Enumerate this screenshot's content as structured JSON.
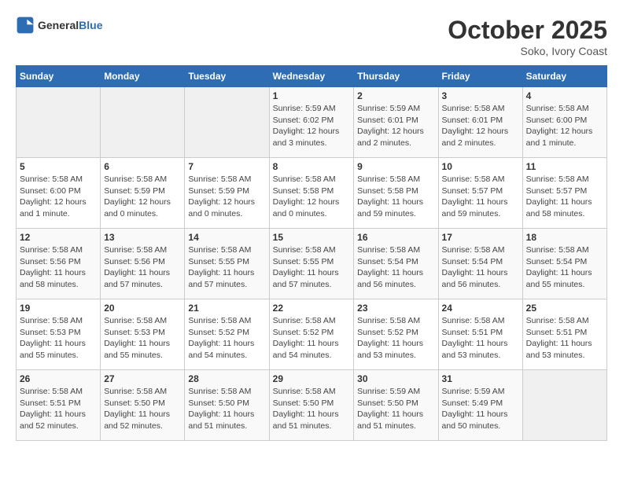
{
  "logo": {
    "text_general": "General",
    "text_blue": "Blue"
  },
  "title": "October 2025",
  "location": "Soko, Ivory Coast",
  "days_of_week": [
    "Sunday",
    "Monday",
    "Tuesday",
    "Wednesday",
    "Thursday",
    "Friday",
    "Saturday"
  ],
  "weeks": [
    [
      {
        "day": "",
        "info": ""
      },
      {
        "day": "",
        "info": ""
      },
      {
        "day": "",
        "info": ""
      },
      {
        "day": "1",
        "info": "Sunrise: 5:59 AM\nSunset: 6:02 PM\nDaylight: 12 hours\nand 3 minutes."
      },
      {
        "day": "2",
        "info": "Sunrise: 5:59 AM\nSunset: 6:01 PM\nDaylight: 12 hours\nand 2 minutes."
      },
      {
        "day": "3",
        "info": "Sunrise: 5:58 AM\nSunset: 6:01 PM\nDaylight: 12 hours\nand 2 minutes."
      },
      {
        "day": "4",
        "info": "Sunrise: 5:58 AM\nSunset: 6:00 PM\nDaylight: 12 hours\nand 1 minute."
      }
    ],
    [
      {
        "day": "5",
        "info": "Sunrise: 5:58 AM\nSunset: 6:00 PM\nDaylight: 12 hours\nand 1 minute."
      },
      {
        "day": "6",
        "info": "Sunrise: 5:58 AM\nSunset: 5:59 PM\nDaylight: 12 hours\nand 0 minutes."
      },
      {
        "day": "7",
        "info": "Sunrise: 5:58 AM\nSunset: 5:59 PM\nDaylight: 12 hours\nand 0 minutes."
      },
      {
        "day": "8",
        "info": "Sunrise: 5:58 AM\nSunset: 5:58 PM\nDaylight: 12 hours\nand 0 minutes."
      },
      {
        "day": "9",
        "info": "Sunrise: 5:58 AM\nSunset: 5:58 PM\nDaylight: 11 hours\nand 59 minutes."
      },
      {
        "day": "10",
        "info": "Sunrise: 5:58 AM\nSunset: 5:57 PM\nDaylight: 11 hours\nand 59 minutes."
      },
      {
        "day": "11",
        "info": "Sunrise: 5:58 AM\nSunset: 5:57 PM\nDaylight: 11 hours\nand 58 minutes."
      }
    ],
    [
      {
        "day": "12",
        "info": "Sunrise: 5:58 AM\nSunset: 5:56 PM\nDaylight: 11 hours\nand 58 minutes."
      },
      {
        "day": "13",
        "info": "Sunrise: 5:58 AM\nSunset: 5:56 PM\nDaylight: 11 hours\nand 57 minutes."
      },
      {
        "day": "14",
        "info": "Sunrise: 5:58 AM\nSunset: 5:55 PM\nDaylight: 11 hours\nand 57 minutes."
      },
      {
        "day": "15",
        "info": "Sunrise: 5:58 AM\nSunset: 5:55 PM\nDaylight: 11 hours\nand 57 minutes."
      },
      {
        "day": "16",
        "info": "Sunrise: 5:58 AM\nSunset: 5:54 PM\nDaylight: 11 hours\nand 56 minutes."
      },
      {
        "day": "17",
        "info": "Sunrise: 5:58 AM\nSunset: 5:54 PM\nDaylight: 11 hours\nand 56 minutes."
      },
      {
        "day": "18",
        "info": "Sunrise: 5:58 AM\nSunset: 5:54 PM\nDaylight: 11 hours\nand 55 minutes."
      }
    ],
    [
      {
        "day": "19",
        "info": "Sunrise: 5:58 AM\nSunset: 5:53 PM\nDaylight: 11 hours\nand 55 minutes."
      },
      {
        "day": "20",
        "info": "Sunrise: 5:58 AM\nSunset: 5:53 PM\nDaylight: 11 hours\nand 55 minutes."
      },
      {
        "day": "21",
        "info": "Sunrise: 5:58 AM\nSunset: 5:52 PM\nDaylight: 11 hours\nand 54 minutes."
      },
      {
        "day": "22",
        "info": "Sunrise: 5:58 AM\nSunset: 5:52 PM\nDaylight: 11 hours\nand 54 minutes."
      },
      {
        "day": "23",
        "info": "Sunrise: 5:58 AM\nSunset: 5:52 PM\nDaylight: 11 hours\nand 53 minutes."
      },
      {
        "day": "24",
        "info": "Sunrise: 5:58 AM\nSunset: 5:51 PM\nDaylight: 11 hours\nand 53 minutes."
      },
      {
        "day": "25",
        "info": "Sunrise: 5:58 AM\nSunset: 5:51 PM\nDaylight: 11 hours\nand 53 minutes."
      }
    ],
    [
      {
        "day": "26",
        "info": "Sunrise: 5:58 AM\nSunset: 5:51 PM\nDaylight: 11 hours\nand 52 minutes."
      },
      {
        "day": "27",
        "info": "Sunrise: 5:58 AM\nSunset: 5:50 PM\nDaylight: 11 hours\nand 52 minutes."
      },
      {
        "day": "28",
        "info": "Sunrise: 5:58 AM\nSunset: 5:50 PM\nDaylight: 11 hours\nand 51 minutes."
      },
      {
        "day": "29",
        "info": "Sunrise: 5:58 AM\nSunset: 5:50 PM\nDaylight: 11 hours\nand 51 minutes."
      },
      {
        "day": "30",
        "info": "Sunrise: 5:59 AM\nSunset: 5:50 PM\nDaylight: 11 hours\nand 51 minutes."
      },
      {
        "day": "31",
        "info": "Sunrise: 5:59 AM\nSunset: 5:49 PM\nDaylight: 11 hours\nand 50 minutes."
      },
      {
        "day": "",
        "info": ""
      }
    ]
  ]
}
